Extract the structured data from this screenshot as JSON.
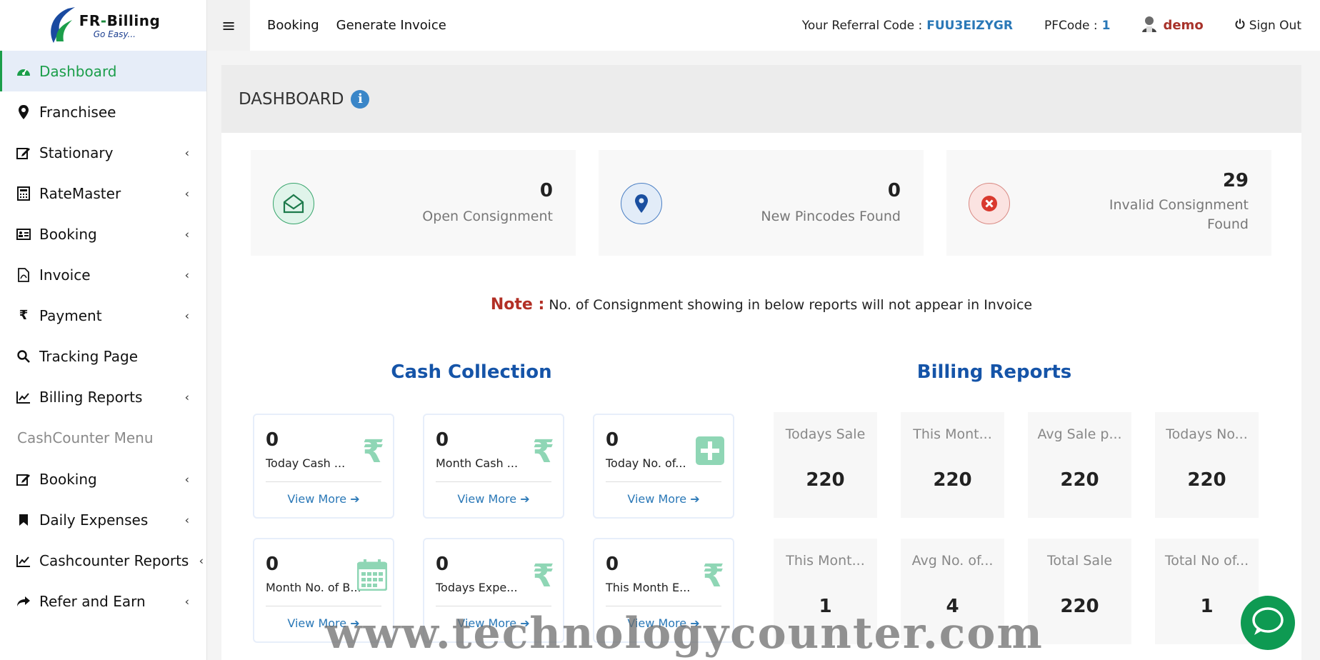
{
  "brand": {
    "title_left": "FR",
    "title_dash": "-",
    "title_right": "Billing",
    "tagline": "Go Easy..."
  },
  "sidebar": {
    "items": [
      {
        "label": "Dashboard",
        "icon": "dashboard-icon"
      },
      {
        "label": "Franchisee",
        "icon": "map-marker-icon"
      },
      {
        "label": "Stationary",
        "icon": "edit-icon"
      },
      {
        "label": "RateMaster",
        "icon": "calculator-icon"
      },
      {
        "label": "Booking",
        "icon": "id-card-icon"
      },
      {
        "label": "Invoice",
        "icon": "pdf-file-icon"
      },
      {
        "label": "Payment",
        "icon": "rupee-icon"
      },
      {
        "label": "Tracking Page",
        "icon": "search-icon"
      },
      {
        "label": "Billing Reports",
        "icon": "line-chart-icon"
      }
    ],
    "cash_heading": "CashCounter Menu",
    "cash_items": [
      {
        "label": "Booking",
        "icon": "edit-icon"
      },
      {
        "label": "Daily Expenses",
        "icon": "bookmark-icon"
      },
      {
        "label": "Cashcounter Reports",
        "icon": "line-chart-icon"
      },
      {
        "label": "Refer and Earn",
        "icon": "share-icon"
      }
    ]
  },
  "topbar": {
    "menu_icon": "≡",
    "links": [
      "Booking",
      "Generate Invoice"
    ],
    "referral_label": "Your Referral Code :",
    "referral_code": "FUU3EIZYGR",
    "pf_label": "PFCode :",
    "pf_value": "1",
    "user": "demo",
    "signout": "Sign Out"
  },
  "page": {
    "title": "DASHBOARD",
    "info": "i"
  },
  "stats": [
    {
      "value": "0",
      "label": "Open Consignment",
      "icon": "envelope-open-icon"
    },
    {
      "value": "0",
      "label": "New Pincodes Found",
      "icon": "map-marker-icon"
    },
    {
      "value": "29",
      "label_line1": "Invalid Consignment",
      "label_line2": "Found",
      "icon": "close-circle-icon"
    }
  ],
  "note": {
    "label": "Note :",
    "text": "No. of Consignment showing in below reports will not appear in Invoice"
  },
  "cash_collection": {
    "title": "Cash Collection",
    "view_more": "View More",
    "cards": [
      {
        "value": "0",
        "label": "Today Cash ...",
        "icon": "₹"
      },
      {
        "value": "0",
        "label": "Month Cash ...",
        "icon": "₹"
      },
      {
        "value": "0",
        "label": "Today No. of...",
        "icon": "plus-square-icon"
      },
      {
        "value": "0",
        "label": "Month No. of B...",
        "icon": "calendar-icon"
      },
      {
        "value": "0",
        "label": "Todays Expe...",
        "icon": "₹"
      },
      {
        "value": "0",
        "label": "This Month E...",
        "icon": "₹"
      }
    ]
  },
  "billing_reports": {
    "title": "Billing Reports",
    "cards": [
      {
        "label": "Todays Sale",
        "value": "220"
      },
      {
        "label": "This Mont...",
        "value": "220"
      },
      {
        "label": "Avg Sale p...",
        "value": "220"
      },
      {
        "label": "Todays No...",
        "value": "220"
      },
      {
        "label": "This Mont...",
        "value": "1"
      },
      {
        "label": "Avg No. of...",
        "value": "4"
      },
      {
        "label": "Total Sale",
        "value": "220"
      },
      {
        "label": "Total No of...",
        "value": "1"
      }
    ]
  },
  "watermark": "www.technologycounter.com",
  "colors": {
    "accent_green": "#1b9e4a",
    "link_blue": "#2a78b7",
    "title_blue": "#1554a8",
    "note_red": "#b22f25"
  }
}
